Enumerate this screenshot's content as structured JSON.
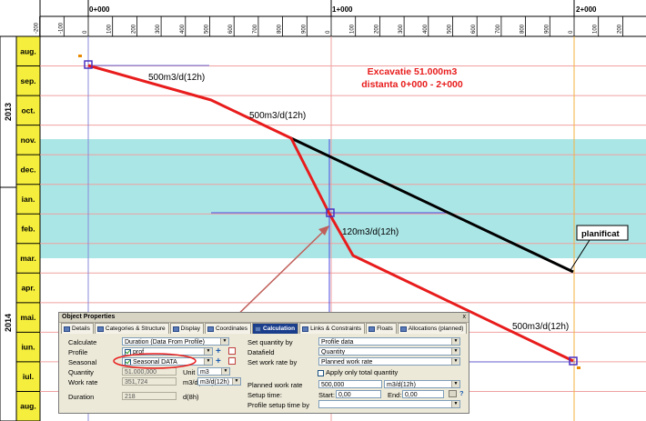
{
  "timeline": {
    "major_labels": [
      "0+000",
      "1+000",
      "2+000"
    ],
    "minor_ticks": [
      "-200",
      "-100",
      "0",
      "100",
      "200",
      "300",
      "400",
      "500",
      "600",
      "700",
      "800",
      "900",
      "0",
      "100",
      "200",
      "300",
      "400",
      "500",
      "600",
      "700",
      "800",
      "900",
      "0",
      "100",
      "200"
    ]
  },
  "years": [
    "2013",
    "2014"
  ],
  "months": [
    "aug.",
    "sep.",
    "oct.",
    "nov.",
    "dec.",
    "ian.",
    "feb.",
    "mar.",
    "apr.",
    "mai.",
    "iun.",
    "iul.",
    "aug."
  ],
  "annotations": {
    "title_line1": "Excavatie 51.000m3",
    "title_line2": "distanta 0+000 - 2+000",
    "rate_1": "500m3/d(12h)",
    "rate_2": "500m3/d(12h)",
    "rate_3": "120m3/d(12h)",
    "rate_4": "500m3/d(12h)",
    "planned_callout": "planificat"
  },
  "colors": {
    "actual_line": "#e81c1c",
    "planned_line": "#000000",
    "highlight_band": "#abe6e6",
    "month_header": "#f5ee3d",
    "grid_red": "#f0a0a0"
  },
  "panel": {
    "title": "Object Properties",
    "close": "x",
    "tabs": [
      "Details",
      "Categories & Structure",
      "Display",
      "Coordinates",
      "Calculation",
      "Links & Constraints",
      "Floats",
      "Allocations (planned)"
    ],
    "active_tab": "Calculation",
    "left": {
      "calculate_label": "Calculate",
      "calculate_value": "Duration (Data From Profile)",
      "profile_label": "Profile",
      "profile_value": "prof",
      "seasonal_label": "Seasonal",
      "seasonal_value": "Seasonal DATA",
      "quantity_label": "Quantity",
      "quantity_value": "51.000,000",
      "unit_label": "Unit",
      "unit_value": "m3",
      "work_rate_label": "Work rate",
      "work_rate_value": "351,724",
      "work_rate_unit": "m3/d(12h)",
      "duration_label": "Duration",
      "duration_value": "218",
      "duration_unit": "d(8h)"
    },
    "right": {
      "set_quantity_label": "Set quantity by",
      "set_quantity_value": "Profile data",
      "datafield_label": "Datafield",
      "datafield_value": "Quantity",
      "set_work_rate_label": "Set work rate by",
      "set_work_rate_value": "Planned work rate",
      "apply_total_label": "Apply only total quantity",
      "planned_work_rate_label": "Planned work rate",
      "planned_work_rate_value": "500,000",
      "planned_work_rate_unit": "m3/d(12h)",
      "setup_time_label": "Setup time:",
      "start_label": "Start:",
      "start_value": "0,00",
      "end_label": "End:",
      "end_value": "0,00",
      "profile_setup_label": "Profile setup time by",
      "profile_setup_value": ""
    }
  }
}
